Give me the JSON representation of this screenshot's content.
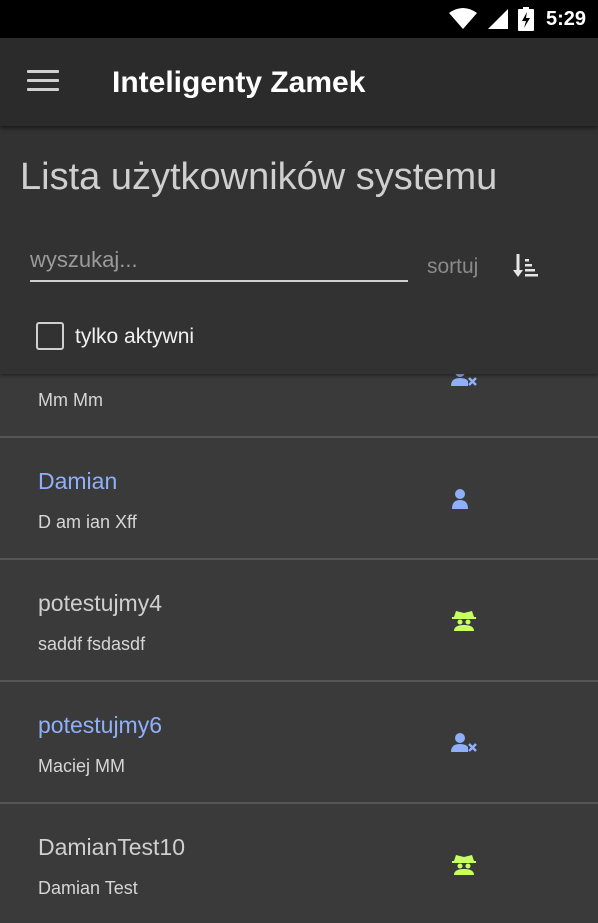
{
  "status_bar": {
    "time": "5:29"
  },
  "app_bar": {
    "title": "Inteligenty Zamek"
  },
  "header": {
    "title": "Lista użytkowników systemu",
    "search_placeholder": "wyszukaj...",
    "search_value": "",
    "sort_label": "sortuj",
    "active_only_label": "tylko aktywni",
    "active_only_checked": false
  },
  "colors": {
    "active_login": "#8fb0f8",
    "inactive_login": "#cfcfcf",
    "user_icon": "#8fb0f8",
    "admin_icon": "#c6ff5e"
  },
  "users": [
    {
      "login": "",
      "name": "Mm Mm",
      "icon": "user-blocked-icon",
      "active": false
    },
    {
      "login": "Damian",
      "name": "D am ian Xff",
      "icon": "user-icon",
      "active": true
    },
    {
      "login": "potestujmy4",
      "name": "saddf fsdasdf",
      "icon": "admin-spy-icon",
      "active": false
    },
    {
      "login": "potestujmy6",
      "name": "Maciej MM",
      "icon": "user-blocked-icon",
      "active": true
    },
    {
      "login": "DamianTest10",
      "name": "Damian Test",
      "icon": "admin-spy-icon",
      "active": false
    }
  ]
}
